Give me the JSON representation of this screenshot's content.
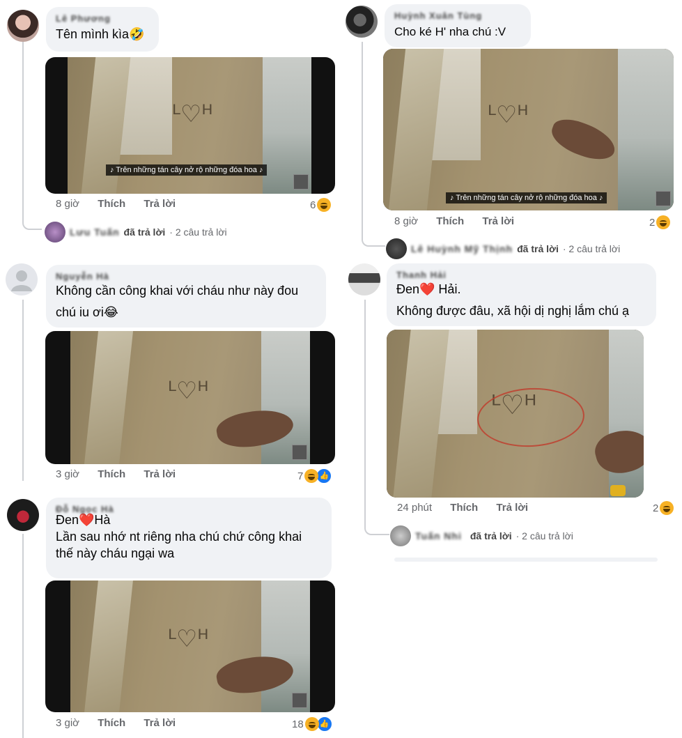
{
  "comments": [
    {
      "name": "Lê Phương",
      "text": "Tên mình kìa🤣",
      "subtitle": "♪ Trên những tán cây nở rộ những đóa hoa ♪",
      "time": "8 giờ",
      "like": "Thích",
      "reply": "Trả lời",
      "reaction_count": "6",
      "reply_name": "Lưu Tuấn",
      "reply_action": "đã trả lời",
      "reply_count": "· 2 câu trả lời"
    },
    {
      "name": "Huỳnh Xuân Tùng",
      "text": "Cho ké H' nha chú :V",
      "subtitle": "♪ Trên những tán cây nở rộ những đóa hoa ♪",
      "time": "8 giờ",
      "like": "Thích",
      "reply": "Trả lời",
      "reaction_count": "2",
      "reply_name": "Lê Huỳnh Mỹ Thịnh",
      "reply_action": "đã trả lời",
      "reply_count": "· 2 câu trả lời"
    },
    {
      "name": "Nguyễn Hà",
      "text": "Không cần công khai với cháu như này đou\nchú iu ơi😂",
      "time": "3 giờ",
      "like": "Thích",
      "reply": "Trả lời",
      "reaction_count": "7"
    },
    {
      "name": "Thanh Hải",
      "text": "Đen❤️ Hải.\nKhông được đâu, xã hội dị nghị lắm chú ạ",
      "time": "24 phút",
      "like": "Thích",
      "reply": "Trả lời",
      "reaction_count": "2",
      "reply_name": "Tuấn Nhi",
      "reply_action": "đã trả lời",
      "reply_count": "· 2 câu trả lời"
    },
    {
      "name": "Đỗ Ngọc Hà",
      "text": "Đen❤️Hà\nLần sau nhớ nt riêng nha chú chứ công khai\nthế này cháu ngại wa",
      "time": "3 giờ",
      "like": "Thích",
      "reply": "Trả lời",
      "reaction_count": "18"
    }
  ],
  "icons": {
    "haha": "haha-reaction-icon",
    "like": "like-reaction-icon"
  },
  "colors": {
    "bubble": "#f0f2f5",
    "meta_text": "#65676b",
    "like_blue": "#1877f2",
    "haha_yellow": "#f7b125"
  }
}
